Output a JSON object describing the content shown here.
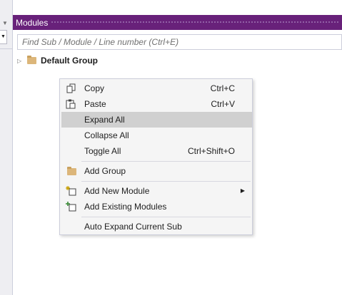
{
  "panel": {
    "title": "Modules",
    "accent_color": "#68217a",
    "search_placeholder": "Find Sub / Module / Line number (Ctrl+E)"
  },
  "tree": {
    "items": [
      {
        "label": "Default Group",
        "icon": "folder-icon",
        "expanded": false
      }
    ]
  },
  "context_menu": {
    "items": [
      {
        "label": "Copy",
        "shortcut": "Ctrl+C",
        "icon": "copy-icon"
      },
      {
        "label": "Paste",
        "shortcut": "Ctrl+V",
        "icon": "paste-icon"
      },
      {
        "label": "Expand All",
        "shortcut": "",
        "highlighted": true
      },
      {
        "label": "Collapse All",
        "shortcut": ""
      },
      {
        "label": "Toggle All",
        "shortcut": "Ctrl+Shift+O"
      },
      {
        "label": "Add Group",
        "shortcut": "",
        "icon": "folder-icon"
      },
      {
        "label": "Add New Module",
        "shortcut": "",
        "icon": "new-module-icon",
        "submenu": true
      },
      {
        "label": "Add Existing Modules",
        "shortcut": "",
        "icon": "add-existing-module-icon"
      },
      {
        "label": "Auto Expand Current Sub",
        "shortcut": ""
      }
    ]
  }
}
